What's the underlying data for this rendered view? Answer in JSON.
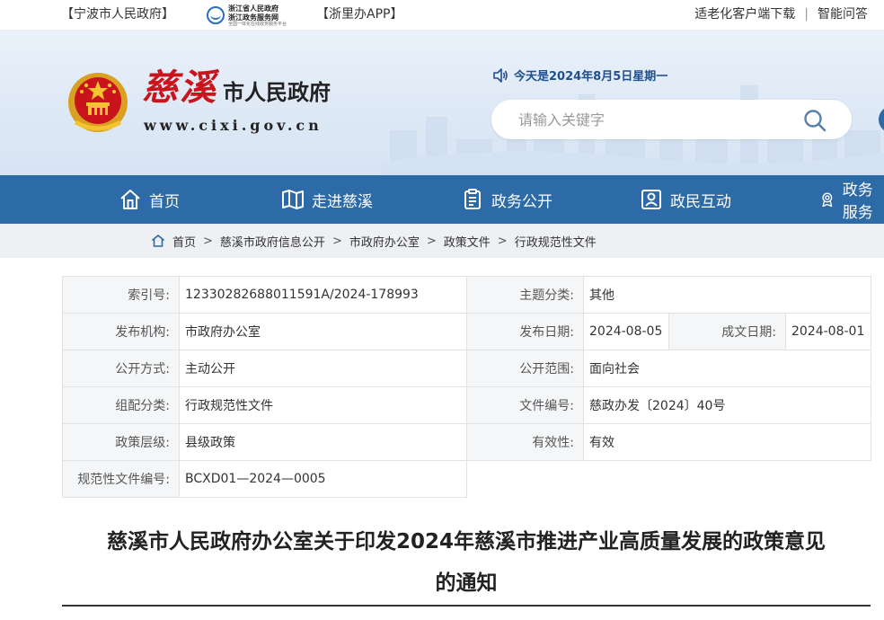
{
  "topbar": {
    "ningbo_link": "【宁波市人民政府】",
    "zj_line1": "浙江省人民政府",
    "zj_line2": "浙江政务服务网",
    "zj_line3": "全国一体化在线政务服务平台",
    "app_link": "【浙里办APP】",
    "elderly_link": "适老化客户端下载",
    "separator": "|",
    "smart_qa_link": "智能问答"
  },
  "header": {
    "site_name_callig": "慈溪",
    "site_name_gov": "市人民政府",
    "site_url": "www.cixi.gov.cn",
    "date_text": "今天是2024年8月5日星期一",
    "search_placeholder": "请输入关键字"
  },
  "nav": {
    "items": [
      {
        "label": "首页",
        "icon": "home-icon"
      },
      {
        "label": "走进慈溪",
        "icon": "map-icon"
      },
      {
        "label": "政务公开",
        "icon": "document-icon"
      },
      {
        "label": "政民互动",
        "icon": "interaction-icon"
      },
      {
        "label": "政务服务",
        "icon": "service-icon"
      }
    ]
  },
  "breadcrumb": {
    "sep": ">",
    "items": [
      "首页",
      "慈溪市政府信息公开",
      "市政府办公室",
      "政策文件",
      "行政规范性文件"
    ]
  },
  "meta": {
    "index_no_label": "索引号:",
    "index_no": "12330282688011591A/2024-178993",
    "topic_label": "主题分类:",
    "topic": "其他",
    "publisher_label": "发布机构:",
    "publisher": "市政府办公室",
    "publish_date_label": "发布日期:",
    "publish_date": "2024-08-05",
    "written_date_label": "成文日期:",
    "written_date": "2024-08-01",
    "disclosure_label": "公开方式:",
    "disclosure": "主动公开",
    "scope_label": "公开范围:",
    "scope": "面向社会",
    "category_label": "组配分类:",
    "category": "行政规范性文件",
    "doc_no_label": "文件编号:",
    "doc_no": "慈政办发〔2024〕40号",
    "level_label": "政策层级:",
    "level": "县级政策",
    "validity_label": "有效性:",
    "validity": "有效",
    "norm_no_label": "规范性文件编号:",
    "norm_no": "BCXD01—2024—0005"
  },
  "document": {
    "title_line1": "慈溪市人民政府办公室关于印发2024年慈溪市推进产业高质量发展的政策意见",
    "title_line2": "的通知"
  },
  "colors": {
    "nav_bg": "#2c6aa8",
    "brand_red": "#c8141a",
    "date_blue": "#1f4f8c",
    "crumb_bg": "#eef0f3"
  }
}
